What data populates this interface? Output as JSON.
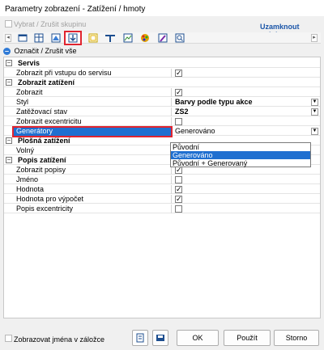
{
  "window": {
    "title": "Parametry zobrazení - Zatížení / hmoty"
  },
  "group_select": {
    "label": "Vybrat / Zrušit skupinu",
    "lock_label": "Uzamknout polohu"
  },
  "toolbar": {
    "icons": [
      "scroll-left-icon",
      "structure-icon",
      "table-icon",
      "layers-icon",
      "load-icon",
      "frame-icon",
      "beam-icon",
      "chart-icon",
      "color-icon",
      "pen-icon",
      "search-icon",
      "scroll-right-icon"
    ]
  },
  "selection": {
    "label": "Označit / Zrušit vše"
  },
  "groups": {
    "servis": {
      "label": "Servis"
    },
    "zobrazit_zatizeni": {
      "label": "Zobrazit zatížení"
    },
    "plosna": {
      "label": "Plošná zatížení"
    },
    "popis": {
      "label": "Popis zatížení"
    }
  },
  "rows": {
    "zobrazit_pri_vstupu": {
      "label": "Zobrazit při vstupu do servisu",
      "checked": true
    },
    "zobrazit": {
      "label": "Zobrazit",
      "checked": true
    },
    "styl": {
      "label": "Styl",
      "value": "Barvy podle typu akce"
    },
    "zatezovaci_stav": {
      "label": "Zatěžovací stav",
      "value": "ZS2"
    },
    "zobrazit_excentricitu": {
      "label": "Zobrazit excentricitu",
      "checked": false
    },
    "generatory": {
      "label": "Generátory",
      "value": "Generováno"
    },
    "volny": {
      "label": "Volný"
    },
    "zobrazit_popisy": {
      "label": "Zobrazit popisy",
      "checked": true
    },
    "jmeno": {
      "label": "Jméno",
      "checked": false
    },
    "hodnota": {
      "label": "Hodnota",
      "checked": true
    },
    "hodnota_pro_vypocet": {
      "label": "Hodnota pro výpočet",
      "checked": true
    },
    "popis_excentricity": {
      "label": "Popis excentricity",
      "checked": false
    }
  },
  "dropdown_options": [
    "Původní",
    "Generováno",
    "Původní + Generovaný"
  ],
  "dropdown_selected_index": 1,
  "footer": {
    "show_names_label": "Zobrazovat jména v záložce",
    "ok_label": "OK",
    "apply_label": "Použít",
    "cancel_label": "Storno"
  },
  "colors": {
    "accent": "#1f6fd0",
    "highlight": "#e0242f",
    "lock": "#1a55a8"
  }
}
